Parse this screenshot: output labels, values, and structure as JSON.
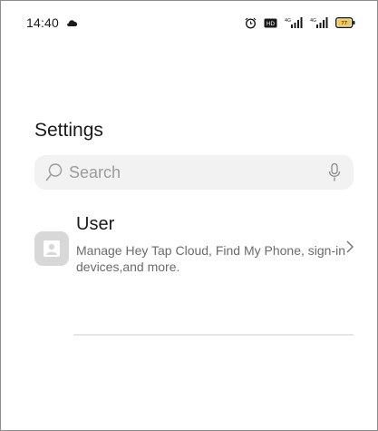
{
  "status_bar": {
    "time": "14:40",
    "icons": [
      "notification-cloud-icon",
      "alarm-icon",
      "hd-icon",
      "signal-4g-icon",
      "signal-4g-icon",
      "battery-icon"
    ],
    "battery_level": "77"
  },
  "header": {
    "title": "Settings"
  },
  "search": {
    "placeholder": "Search",
    "icon": "search-icon",
    "mic_icon": "microphone-icon"
  },
  "user_item": {
    "title": "User",
    "description": "Manage Hey Tap Cloud, Find My Phone, sign-in devices,and more.",
    "icon": "user-avatar-icon",
    "chevron": "chevron-right-icon"
  },
  "colors": {
    "background": "#ffffff",
    "search_bg": "#f2f2f2",
    "primary_text": "#1a1a1a",
    "secondary_text": "#6b6b6b",
    "placeholder": "#9b9b9b",
    "avatar_bg": "#d8d8d8",
    "battery_fill": "#f2c94c"
  }
}
